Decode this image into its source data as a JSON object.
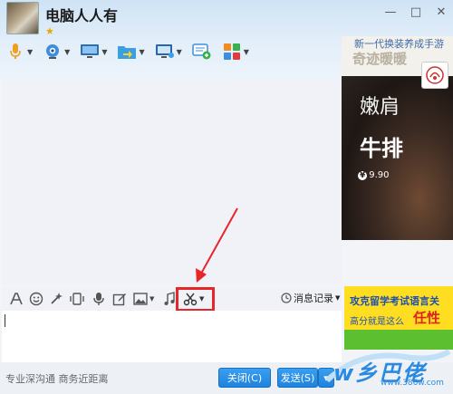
{
  "window": {
    "title": "电脑人人有",
    "star": "★",
    "controls": [
      "minimize",
      "maximize",
      "close"
    ]
  },
  "toolbar": [
    {
      "name": "voice-call",
      "icon": "microphone-icon",
      "dropdown": true
    },
    {
      "name": "video-call",
      "icon": "webcam-icon",
      "dropdown": true
    },
    {
      "name": "screen-share",
      "icon": "monitor-icon",
      "dropdown": true
    },
    {
      "name": "send-file",
      "icon": "folder-icon",
      "dropdown": true
    },
    {
      "name": "remote-desktop",
      "icon": "remote-desktop-icon",
      "dropdown": true
    },
    {
      "name": "create-group",
      "icon": "chat-add-icon",
      "dropdown": false
    },
    {
      "name": "app-center",
      "icon": "apps-grid-icon",
      "dropdown": true
    }
  ],
  "ad_panel": {
    "line1": "新一代换装养成手游",
    "line2": "奇迹暖暖",
    "big1": "嫩肩",
    "big2": "牛排",
    "price": "9.90",
    "currency": "¥"
  },
  "input_toolbar": {
    "items": [
      "font-icon",
      "emoji-icon",
      "magic-wand-icon",
      "vibrate-icon",
      "voice-message-icon",
      "edit-icon",
      "image-icon",
      "music-icon",
      "scissors-icon"
    ],
    "history_label": "消息记录"
  },
  "promo": {
    "line1": "攻克留学考试语言关",
    "line2": "高分就是这么",
    "line3": "任性"
  },
  "bottom": {
    "slogan": "专业深沟通 商务近距离",
    "close_label": "关闭(C)",
    "send_label": "发送(S)",
    "dropdown": "▾"
  },
  "watermark": {
    "title": "w乡巴佬",
    "url": "www.386w.com"
  },
  "colors": {
    "accent": "#1f83de",
    "highlight": "#e8262a",
    "header": "#cfe3f5"
  }
}
